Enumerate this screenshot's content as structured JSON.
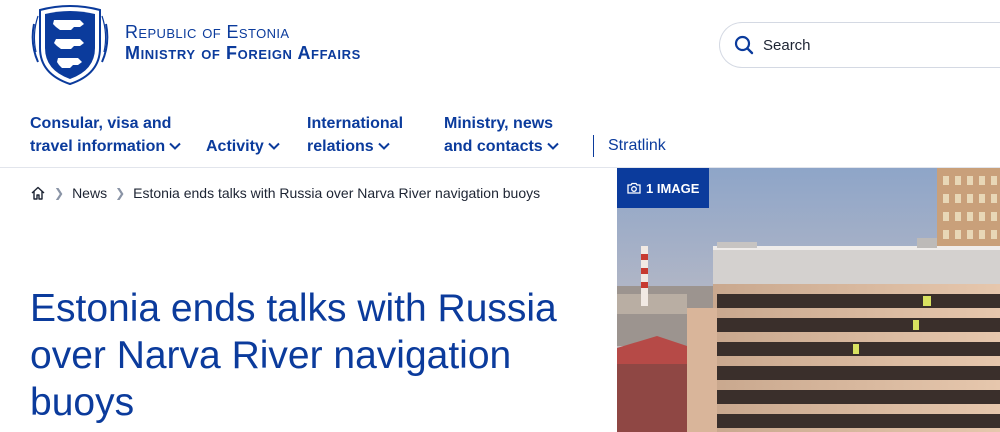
{
  "site": {
    "name_line1": "Republic of Estonia",
    "name_line2": "Ministry of Foreign Affairs"
  },
  "search": {
    "label": "Search"
  },
  "nav": {
    "items": [
      {
        "label_line1": "Consular, visa and",
        "label_line2": "travel information"
      },
      {
        "label_line1": "",
        "label_line2": "Activity"
      },
      {
        "label_line1": "International",
        "label_line2": "relations"
      },
      {
        "label_line1": "Ministry, news",
        "label_line2": "and contacts"
      }
    ],
    "extra_link": "Stratlink"
  },
  "breadcrumb": {
    "home_icon": "home-icon",
    "items": [
      "News",
      "Estonia ends talks with Russia over Narva River navigation buoys"
    ]
  },
  "article": {
    "title": "Estonia ends talks with Russia over Narva River navigation buoys"
  },
  "hero": {
    "badge_icon": "camera-icon",
    "badge_label": "1 IMAGE"
  },
  "colors": {
    "brand_blue": "#0b3b9c",
    "text_dark": "#1d2433",
    "divider": "#e2e5ec"
  }
}
